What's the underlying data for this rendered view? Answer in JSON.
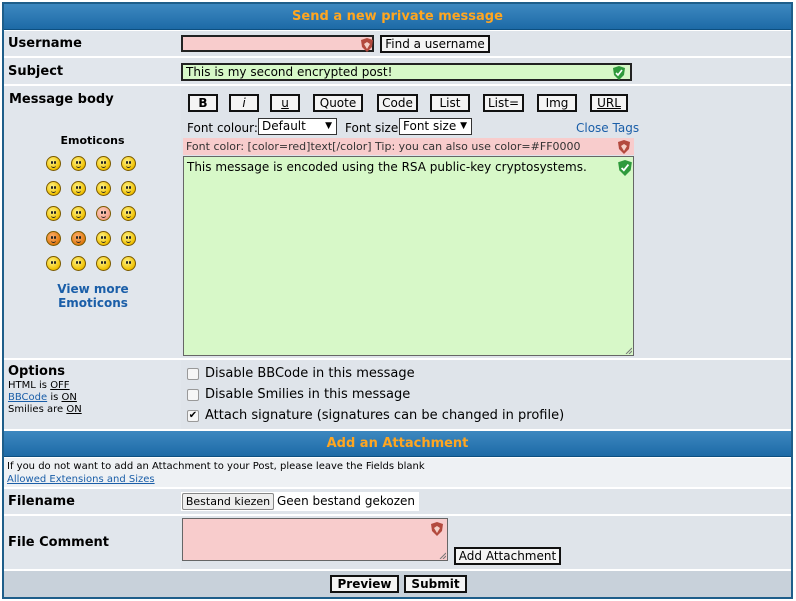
{
  "header_title": "Send a new private message",
  "username": {
    "label": "Username",
    "value": "",
    "find_button": "Find a username"
  },
  "subject": {
    "label": "Subject",
    "value": "This is my second encrypted post!"
  },
  "message": {
    "label": "Message body",
    "bbcode_buttons": [
      "B",
      "i",
      "u",
      "Quote",
      "Code",
      "List",
      "List=",
      "Img",
      "URL"
    ],
    "font_colour_label": "Font colour:",
    "font_colour_value": "Default",
    "font_size_label": "Font size:",
    "font_size_value": "Font size",
    "close_tags": "Close Tags",
    "help_text": "Font color: [color=red]text[/color]  Tip: you can also use color=#FF0000",
    "body_text": "This message is encoded using the RSA public-key cryptosystems."
  },
  "emoticons": {
    "title": "Emoticons",
    "view_more": "View more Emoticons"
  },
  "options": {
    "label": "Options",
    "html_prefix": "HTML is ",
    "html_state": "OFF",
    "bbcode_link": "BBCode",
    "bbcode_mid": " is ",
    "bbcode_state": "ON",
    "smilies_prefix": "Smilies are ",
    "smilies_state": "ON",
    "checkboxes": [
      {
        "label": "Disable BBCode in this message",
        "checked": false
      },
      {
        "label": "Disable Smilies in this message",
        "checked": false
      },
      {
        "label": "Attach signature (signatures can be changed in profile)",
        "checked": true
      }
    ]
  },
  "attachment": {
    "title": "Add an Attachment",
    "note": "If you do not want to add an Attachment to your Post, please leave the Fields blank",
    "allowed_link": "Allowed Extensions and Sizes",
    "filename_label": "Filename",
    "choose_button": "Bestand kiezen",
    "no_file": "Geen bestand gekozen",
    "comment_label": "File Comment",
    "add_button": "Add Attachment"
  },
  "actions": {
    "preview": "Preview",
    "submit": "Submit"
  },
  "colors": {
    "header_bg": "#1d6aa6",
    "header_text": "#ffa620",
    "field_pink": "#f8cccc",
    "field_green": "#d7f8c8"
  }
}
